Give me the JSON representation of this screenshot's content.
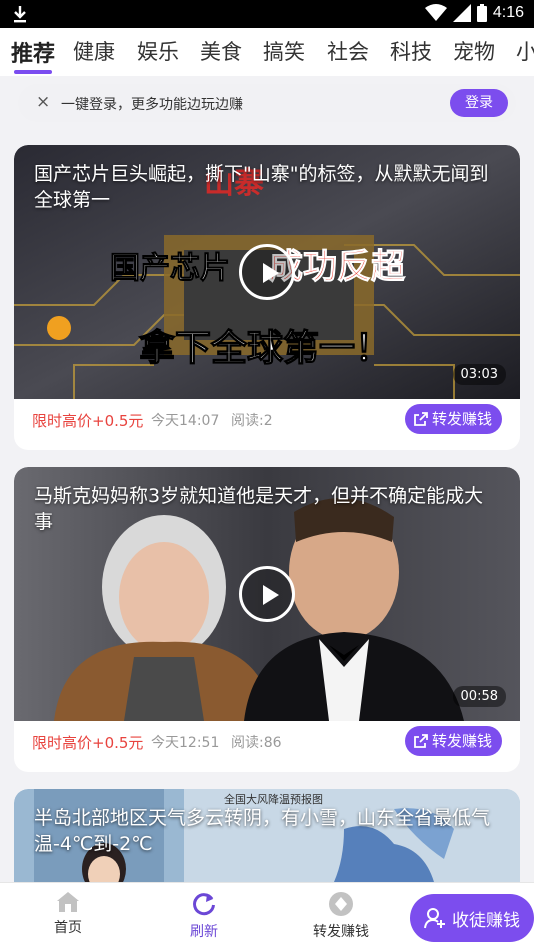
{
  "status": {
    "time": "4:16"
  },
  "tabs": [
    "推荐",
    "健康",
    "娱乐",
    "美食",
    "搞笑",
    "社会",
    "科技",
    "宠物",
    "小"
  ],
  "login_bar": {
    "text": "一键登录，更多功能边玩边赚",
    "button": "登录",
    "close": "×"
  },
  "cards": [
    {
      "title": "国产芯片巨头崛起，撕下\"山寨\"的标签，从默默无闻到全球第一",
      "overlay": [
        "国产芯片",
        "成功反超",
        "拿下全球第一！",
        "山寨"
      ],
      "duration": "03:03",
      "price": "限时高价+0.5元",
      "time": "今天14:07",
      "reads": "阅读:2",
      "share": "转发赚钱"
    },
    {
      "title": "马斯克妈妈称3岁就知道他是天才，但并不确定能成大事",
      "duration": "00:58",
      "price": "限时高价+0.5元",
      "time": "今天12:51",
      "reads": "阅读:86",
      "share": "转发赚钱"
    },
    {
      "title": "半岛北部地区天气多云转阴，有小雪，山东全省最低气温-4℃到-2℃",
      "map_title": "全国大风降温预报图"
    }
  ],
  "bottom_nav": {
    "home": "首页",
    "refresh": "刷新",
    "share": "转发赚钱",
    "invite": "收徒赚钱"
  },
  "colors": {
    "accent": "#7c4dee",
    "price": "#e8433e"
  }
}
